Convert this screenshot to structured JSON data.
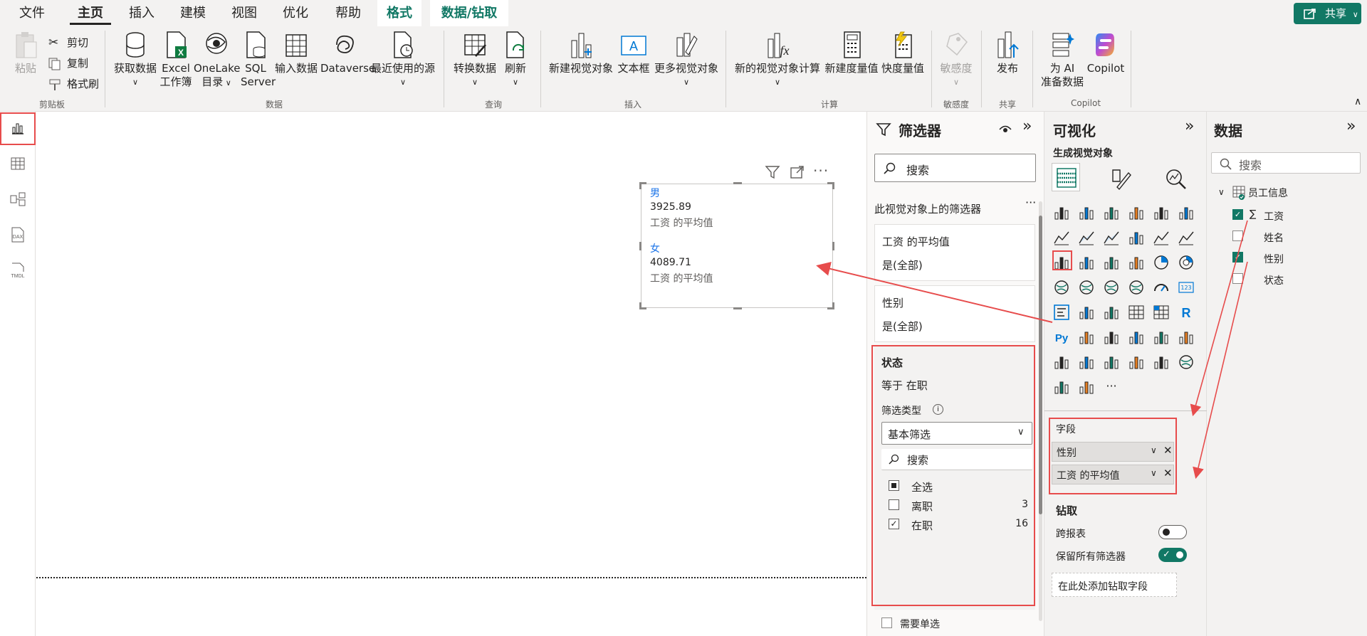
{
  "menu": {
    "items": [
      {
        "label": "文件"
      },
      {
        "label": "主页"
      },
      {
        "label": "插入"
      },
      {
        "label": "建模"
      },
      {
        "label": "视图"
      },
      {
        "label": "优化"
      },
      {
        "label": "帮助"
      },
      {
        "label": "格式"
      },
      {
        "label": "数据/钻取"
      }
    ],
    "share_label": "共享"
  },
  "ribbon": {
    "clipboard": {
      "paste": "粘贴",
      "cut": "剪切",
      "copy": "复制",
      "format_painter": "格式刷",
      "group": "剪贴板"
    },
    "data": {
      "get_data": "获取数据",
      "excel_l1": "Excel",
      "excel_l2": "工作簿",
      "onelake_l1": "OneLake",
      "onelake_l2": "目录",
      "sql_l1": "SQL",
      "sql_l2": "Server",
      "enter_data": "输入数据",
      "dataverse": "Dataverse",
      "recent_sources": "最近使用的源",
      "group": "数据"
    },
    "query": {
      "transform": "转换数据",
      "refresh": "刷新",
      "group": "查询"
    },
    "insert": {
      "new_visual": "新建视觉对象",
      "text_box": "文本框",
      "more_visuals": "更多视觉对象",
      "group": "插入"
    },
    "calc": {
      "new_visual_calc": "新的视觉对象计算",
      "new_measure": "新建度量值",
      "quick_measure": "快度量值",
      "group": "计算"
    },
    "sensitivity": {
      "label": "敏感度",
      "group": "敏感度"
    },
    "share": {
      "publish": "发布",
      "group": "共享"
    },
    "copilot": {
      "prep_l1": "为 AI",
      "prep_l2": "准备数据",
      "copilot": "Copilot",
      "group": "Copilot"
    }
  },
  "card": {
    "rows": [
      {
        "category": "男",
        "value": "3925.89",
        "label": "工资 的平均值"
      },
      {
        "category": "女",
        "value": "4089.71",
        "label": "工资 的平均值"
      }
    ]
  },
  "filters": {
    "title": "筛选器",
    "search_placeholder": "搜索",
    "section_title": "此视觉对象上的筛选器",
    "cards": [
      {
        "name": "工资 的平均值",
        "value": "是(全部)"
      },
      {
        "name": "性别",
        "value": "是(全部)"
      }
    ],
    "status": {
      "name": "状态",
      "condition": "等于 在职",
      "filter_type_label": "筛选类型",
      "filter_type": "基本筛选",
      "search_placeholder": "搜索",
      "options": [
        {
          "label": "全选",
          "count": ""
        },
        {
          "label": "离职",
          "count": "3"
        },
        {
          "label": "在职",
          "count": "16"
        }
      ]
    },
    "require_single": "需要单选"
  },
  "viz": {
    "title": "可视化",
    "subtitle": "生成视觉对象",
    "fields_label": "字段",
    "fields": [
      {
        "label": "性别"
      },
      {
        "label": "工资 的平均值"
      }
    ],
    "drill_title": "钻取",
    "cross_report": "跨报表",
    "keep_filters": "保留所有筛选器",
    "add_drill": "在此处添加钻取字段"
  },
  "data_pane": {
    "title": "数据",
    "search_placeholder": "搜索",
    "table": "员工信息",
    "fields": [
      {
        "label": "工资",
        "sigma": "∑",
        "checked": true
      },
      {
        "label": "姓名",
        "sigma": "",
        "checked": false
      },
      {
        "label": "性别",
        "sigma": "",
        "checked": true
      },
      {
        "label": "状态",
        "sigma": "",
        "checked": false
      }
    ]
  },
  "colors": {
    "accent": "#117865",
    "annotation": "#e74c4c",
    "link": "#1a73e8"
  }
}
